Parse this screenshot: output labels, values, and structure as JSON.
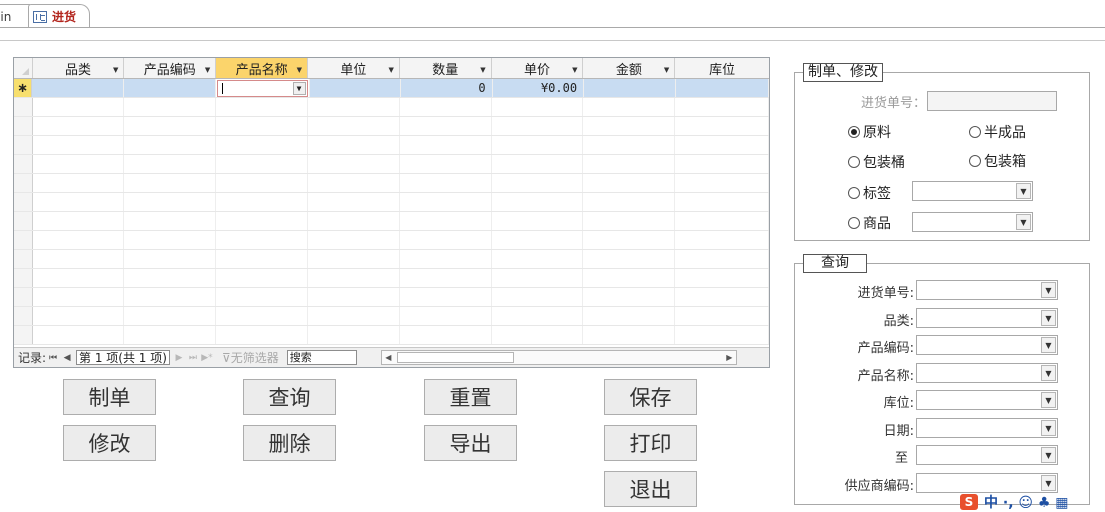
{
  "tabs": [
    {
      "label": "ain",
      "active": false
    },
    {
      "label": "进货",
      "active": true
    }
  ],
  "grid": {
    "columns": [
      "品类",
      "产品编码",
      "产品名称",
      "单位",
      "数量",
      "单价",
      "金额",
      "库位"
    ],
    "new_row": {
      "selector": "∗",
      "quantity": "0",
      "price": "¥0.00"
    },
    "nav": {
      "record_label": "记录:",
      "position": "第 1 项(共 1 项)",
      "no_filter": "无筛选器",
      "search": "搜索"
    }
  },
  "buttons": {
    "create": "制单",
    "query": "查询",
    "reset": "重置",
    "save": "保存",
    "modify": "修改",
    "delete": "删除",
    "export": "导出",
    "print": "打印",
    "exit": "退出"
  },
  "edit_group": {
    "title": "制单、修改",
    "order_no_label": "进货单号：",
    "radio_raw": "原料",
    "radio_semi": "半成品",
    "radio_bucket": "包装桶",
    "radio_box": "包装箱",
    "radio_label": "标签",
    "radio_goods": "商品"
  },
  "query_group": {
    "title": "查询",
    "order_no": "进货单号:",
    "category": "品类:",
    "product_code": "产品编码:",
    "product_name": "产品名称:",
    "location": "库位:",
    "date": "日期:",
    "to": "至",
    "supplier_code": "供应商编码:"
  },
  "ime": {
    "logo": "S",
    "text": "中 ·, ☺ ♣ ▦"
  }
}
